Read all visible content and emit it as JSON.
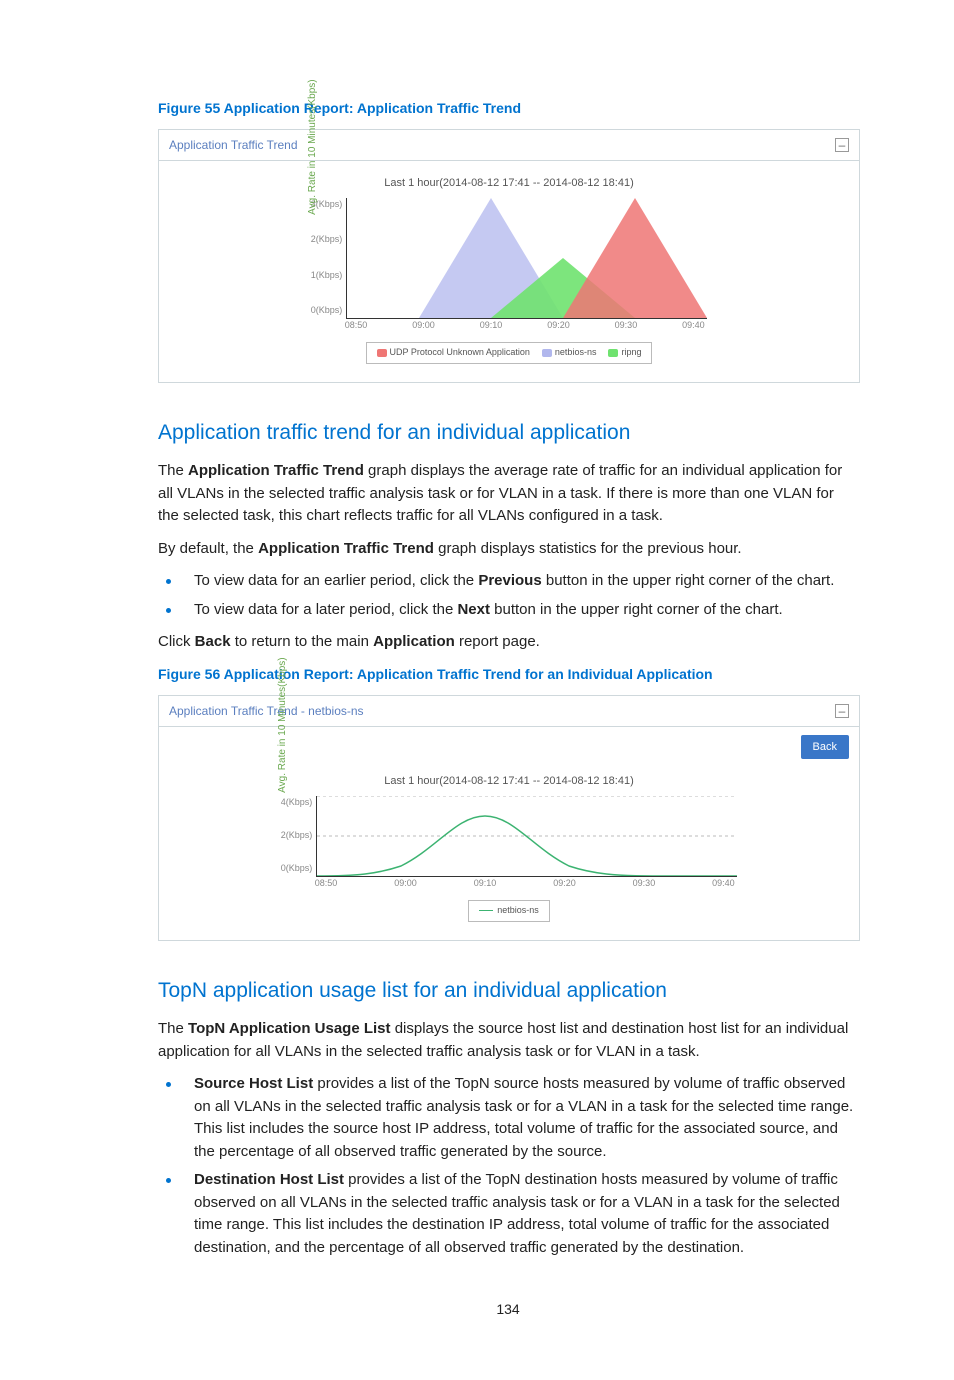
{
  "figure55": {
    "caption": "Figure 55 Application Report: Application Traffic Trend",
    "panel_title": "Application Traffic Trend",
    "collapse_glyph": "–"
  },
  "section1": {
    "heading": "Application traffic trend for an individual application",
    "p1_a": "The ",
    "p1_b": "Application Traffic Trend",
    "p1_c": " graph displays the average rate of traffic for an individual application for all VLANs in the selected traffic analysis task or for VLAN in a task. If there is more than one VLAN for the selected task, this chart reflects traffic for all VLANs configured in a task.",
    "p2_a": "By default, the ",
    "p2_b": "Application Traffic Trend",
    "p2_c": " graph displays statistics for the previous hour.",
    "li1_a": "To view data for an earlier period, click the ",
    "li1_b": "Previous",
    "li1_c": " button in the upper right corner of the chart.",
    "li2_a": "To view data for a later period, click the ",
    "li2_b": "Next",
    "li2_c": " button in the upper right corner of the chart.",
    "p3_a": "Click ",
    "p3_b": "Back",
    "p3_c": " to return to the main ",
    "p3_d": "Application",
    "p3_e": " report page."
  },
  "figure56": {
    "caption": "Figure 56 Application Report: Application Traffic Trend for an Individual Application",
    "panel_title": "Application Traffic Trend - netbios-ns",
    "collapse_glyph": "–",
    "back_label": "Back"
  },
  "section2": {
    "heading": "TopN application usage list for an individual application",
    "p1_a": "The ",
    "p1_b": "TopN Application Usage List",
    "p1_c": " displays the source host list and destination host list for an individual application for all VLANs in the selected traffic analysis task or for VLAN in a task.",
    "li1_a": "Source Host List",
    "li1_b": " provides a list of the TopN source hosts measured by volume of traffic observed on all VLANs in the selected traffic analysis task or for a VLAN in a task for the selected time range. This list includes the source host IP address, total volume of traffic for the associated source, and the percentage of all observed traffic generated by the source.",
    "li2_a": "Destination Host List",
    "li2_b": " provides a list of the TopN destination hosts measured by volume of traffic observed on all VLANs in the selected traffic analysis task or for a VLAN in a task for the selected time range. This list includes the destination IP address, total volume of traffic for the associated destination, and the percentage of all observed traffic generated by the destination."
  },
  "pagenum": "134",
  "chart_data": [
    {
      "type": "area",
      "title": "Last 1 hour(2014-08-12 17:41 -- 2014-08-12 18:41)",
      "ylabel": "Avg. Rate in 10 Minutes(Kbps)",
      "yticks": [
        "3(Kbps)",
        "2(Kbps)",
        "1(Kbps)",
        "0(Kbps)"
      ],
      "ylim": [
        0,
        3
      ],
      "xticks": [
        "08:50",
        "09:00",
        "09:10",
        "09:20",
        "09:30",
        "09:40"
      ],
      "x": [
        "08:50",
        "09:00",
        "09:10",
        "09:20",
        "09:30",
        "09:40"
      ],
      "series": [
        {
          "name": "UDP Protocol Unknown Application",
          "color": "#ef7674",
          "values": [
            0,
            0,
            0,
            0,
            3,
            0
          ]
        },
        {
          "name": "netbios-ns",
          "color": "#b1b7ed",
          "values": [
            0,
            0,
            3,
            0,
            0,
            0
          ]
        },
        {
          "name": "ripng",
          "color": "#6fe26f",
          "values": [
            0,
            0,
            0,
            1.5,
            0,
            0
          ]
        }
      ]
    },
    {
      "type": "line",
      "title": "Last 1 hour(2014-08-12 17:41 -- 2014-08-12 18:41)",
      "ylabel": "Avg. Rate in 10 Minutes(Kbps)",
      "yticks": [
        "4(Kbps)",
        "2(Kbps)",
        "0(Kbps)"
      ],
      "ylim": [
        0,
        4
      ],
      "xticks": [
        "08:50",
        "09:00",
        "09:10",
        "09:20",
        "09:30",
        "09:40"
      ],
      "x": [
        "08:50",
        "09:00",
        "09:10",
        "09:20",
        "09:30",
        "09:40"
      ],
      "series": [
        {
          "name": "netbios-ns",
          "color": "#3cb371",
          "values": [
            0,
            0.5,
            3,
            0.5,
            0,
            0
          ]
        }
      ]
    }
  ]
}
